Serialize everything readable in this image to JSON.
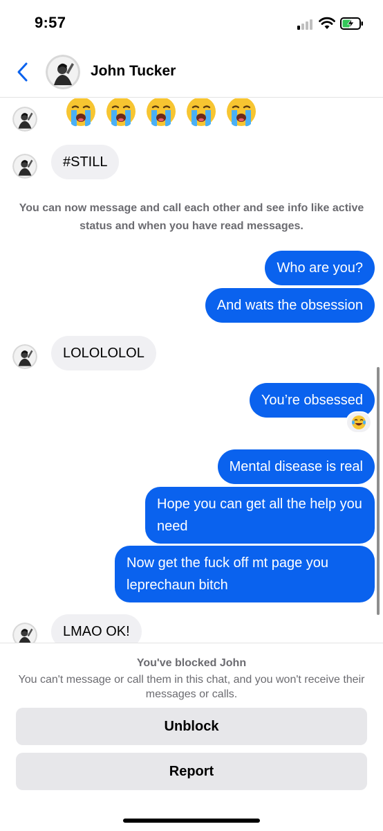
{
  "status_bar": {
    "time": "9:57",
    "signal_icon": "cellular-signal-icon",
    "wifi_icon": "wifi-icon",
    "battery_icon": "battery-charging-icon"
  },
  "header": {
    "back_icon": "chevron-left-icon",
    "contact_name": "John Tucker"
  },
  "messages": [
    {
      "from": "them",
      "kind": "emoji",
      "emoji": "😭😭😭😭😭"
    },
    {
      "from": "them",
      "text": "#STILL"
    },
    {
      "from": "system",
      "text": "You can now message and call each other and see info like active status and when you have read messages."
    },
    {
      "from": "me",
      "text": "Who are you?"
    },
    {
      "from": "me",
      "text": "And wats the obsession"
    },
    {
      "from": "them",
      "text": "LOLOLOLOL"
    },
    {
      "from": "me",
      "text": "You’re obsessed",
      "reaction": "😂"
    },
    {
      "from": "me",
      "text": "Mental disease is real"
    },
    {
      "from": "me",
      "text": "Hope you can get all the help you need"
    },
    {
      "from": "me",
      "text": "Now get the fuck off mt page you leprechaun bitch"
    },
    {
      "from": "them",
      "text": "LMAO OK!"
    }
  ],
  "blocked": {
    "title": "You've blocked John",
    "description": "You can't message or call them in this chat, and you won't receive their messages or calls.",
    "unblock_label": "Unblock",
    "report_label": "Report"
  },
  "colors": {
    "accent": "#0a62ee",
    "incoming_bubble": "#f0f0f3",
    "button_bg": "#e7e7ea",
    "muted_text": "#6b6b70"
  }
}
